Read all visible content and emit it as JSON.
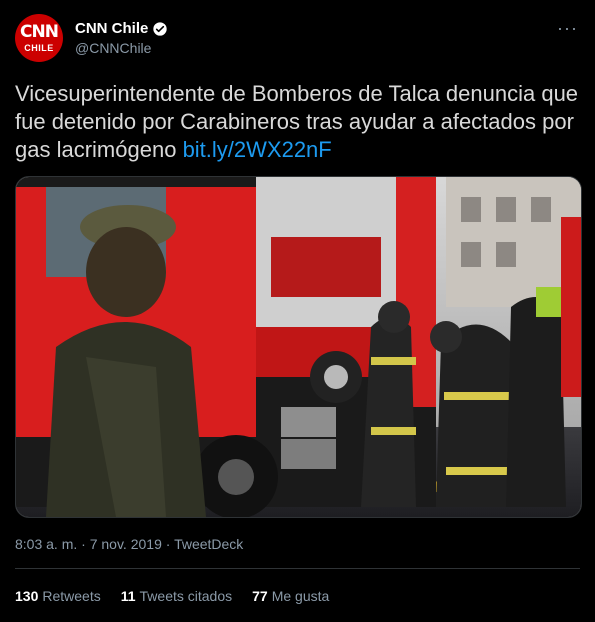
{
  "account": {
    "avatar_top": "CNN",
    "avatar_bottom": "CHILE",
    "display_name": "CNN Chile",
    "handle": "@CNNChile"
  },
  "tweet": {
    "text": "Vicesuperintendente de Bomberos de Talca denuncia que fue detenido por Carabineros tras ayudar a afectados por gas lacrimógeno",
    "link": "bit.ly/2WX22nF"
  },
  "meta": {
    "time": "8:03 a. m.",
    "sep1": " · ",
    "date": "7 nov. 2019",
    "sep2": " · ",
    "source": "TweetDeck"
  },
  "stats": {
    "retweets_count": "130",
    "retweets_label": "Retweets",
    "quotes_count": "11",
    "quotes_label": "Tweets citados",
    "likes_count": "77",
    "likes_label": "Me gusta"
  },
  "icons": {
    "verified": "verified-badge-icon",
    "more": "more-options-icon"
  },
  "colors": {
    "background": "#000000",
    "link": "#1d9bf0",
    "secondary_text": "#8b9aa8",
    "brand_red": "#cc0000"
  }
}
